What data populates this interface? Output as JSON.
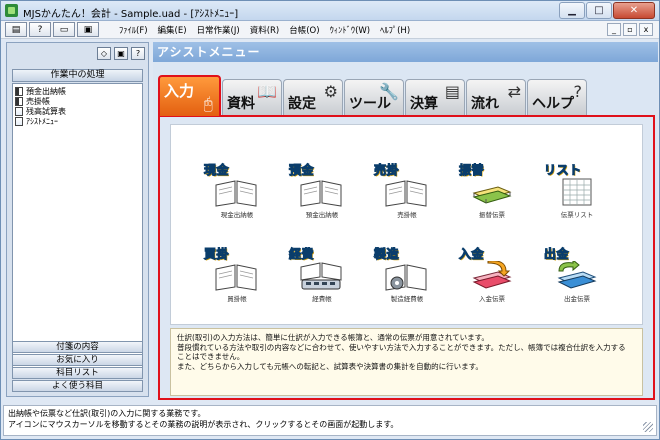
{
  "window": {
    "title": "MJSかんたん！会計 - Sample.uad - [ｱｼｽﾄﾒﾆｭｰ]",
    "min_label": "▁",
    "max_label": "□",
    "close_label": "✕"
  },
  "toolbar": {
    "btn1": "▤",
    "btn2": "?",
    "btn3": "▭",
    "btn4": "▣"
  },
  "menu": {
    "items": [
      "ﾌｧｲﾙ(F)",
      "編集(E)",
      "日常作業(J)",
      "資料(R)",
      "台帳(O)",
      "ｳｨﾝﾄﾞｳ(W)",
      "ﾍﾙﾌﾟ(H)"
    ],
    "mdi_min": "_",
    "mdi_restore": "▫",
    "mdi_close": "x"
  },
  "left_panel": {
    "icons": [
      "◇",
      "▣",
      "?"
    ],
    "heading": "作業中の処理",
    "items": [
      "預金出納帳",
      "売掛帳",
      "残高試算表",
      "ｱｼｽﾄﾒﾆｭｰ"
    ],
    "buttons": [
      "付箋の内容",
      "お気に入り",
      "科目リスト",
      "よく使う科目"
    ]
  },
  "main": {
    "header": "アシストメニュー",
    "tabs": [
      {
        "label": "入力",
        "icon": "mouse-icon"
      },
      {
        "label": "資料",
        "icon": "book-icon"
      },
      {
        "label": "設定",
        "icon": "gears-icon"
      },
      {
        "label": "ツール",
        "icon": "tools-icon"
      },
      {
        "label": "決算",
        "icon": "document-icon"
      },
      {
        "label": "流れ",
        "icon": "flow-icon"
      },
      {
        "label": "ヘルプ",
        "icon": "question-icon"
      }
    ],
    "items": [
      {
        "title": "現金",
        "caption": "現金出納帳"
      },
      {
        "title": "預金",
        "caption": "預金出納帳"
      },
      {
        "title": "売掛",
        "caption": "売掛帳"
      },
      {
        "title": "振替",
        "caption": "振替伝票"
      },
      {
        "title": "リスト",
        "caption": "伝票リスト"
      },
      {
        "title": "買掛",
        "caption": "買掛帳"
      },
      {
        "title": "経費",
        "caption": "経費帳"
      },
      {
        "title": "製造",
        "caption": "製造経費帳"
      },
      {
        "title": "入金",
        "caption": "入金伝票"
      },
      {
        "title": "出金",
        "caption": "出金伝票"
      }
    ],
    "description": [
      "仕訳(取引)の入力方法は、簡単に仕訳が入力できる帳簿と、通常の伝票が用意されています。",
      "普段慣れている方法や取引の内容などに合わせて、使いやすい方法で入力することができます。ただし、帳簿では複合仕訳を入力する",
      "ことはできません。",
      "また、どちらから入力しても元帳への転記と、試算表や決算書の集計を自動的に行います。"
    ]
  },
  "status": {
    "line1": "出納帳や伝票など仕訳(取引)の入力に関する業務です。",
    "line2": "アイコンにマウスカーソルを移動するとその業務の説明が表示され、クリックするとその画面が起動します。"
  },
  "colors": {
    "accent_red": "#e0101a",
    "active_tab": "#ff8a2a",
    "header_blue": "#7ea7d8"
  }
}
